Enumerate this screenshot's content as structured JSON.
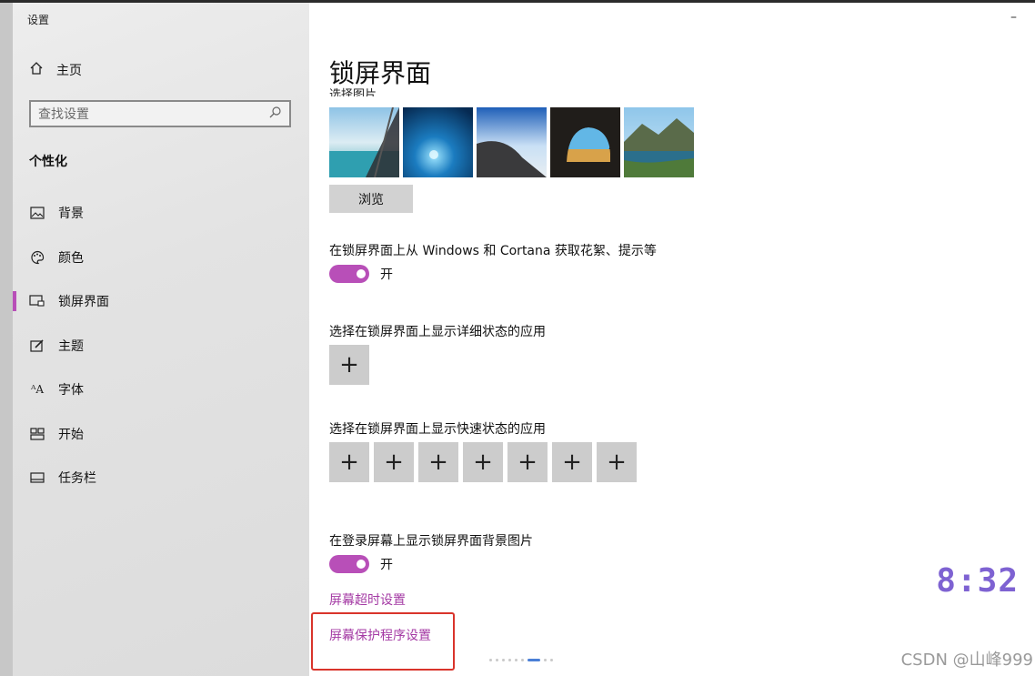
{
  "window": {
    "title": "设置",
    "minimize_glyph": "–"
  },
  "sidebar": {
    "home_label": "主页",
    "search_placeholder": "查找设置",
    "section_title": "个性化",
    "items": [
      {
        "label": "背景",
        "icon": "picture-icon"
      },
      {
        "label": "颜色",
        "icon": "palette-icon"
      },
      {
        "label": "锁屏界面",
        "icon": "lockscreen-icon",
        "active": true
      },
      {
        "label": "主题",
        "icon": "theme-icon"
      },
      {
        "label": "字体",
        "icon": "font-icon"
      },
      {
        "label": "开始",
        "icon": "start-icon"
      },
      {
        "label": "任务栏",
        "icon": "taskbar-icon"
      }
    ]
  },
  "main": {
    "title": "锁屏界面",
    "choose_picture_label": "选择图片",
    "browse_label": "浏览",
    "spotlight_label": "在锁屏界面上从 Windows 和 Cortana 获取花絮、提示等",
    "spotlight_state": "开",
    "detailed_status_label": "选择在锁屏界面上显示详细状态的应用",
    "quick_status_label": "选择在锁屏界面上显示快速状态的应用",
    "plus_glyph": "+",
    "signin_bg_label": "在登录屏幕上显示锁屏界面背景图片",
    "signin_bg_state": "开",
    "screen_timeout_link": "屏幕超时设置",
    "screensaver_link": "屏幕保护程序设置"
  },
  "overlay": {
    "clock": "8:32",
    "watermark": "CSDN @山峰999"
  },
  "colors": {
    "accent": "#b84fb8",
    "link": "#a43aa4",
    "highlight_box": "#d9342b",
    "clock": "#7e62d2"
  }
}
